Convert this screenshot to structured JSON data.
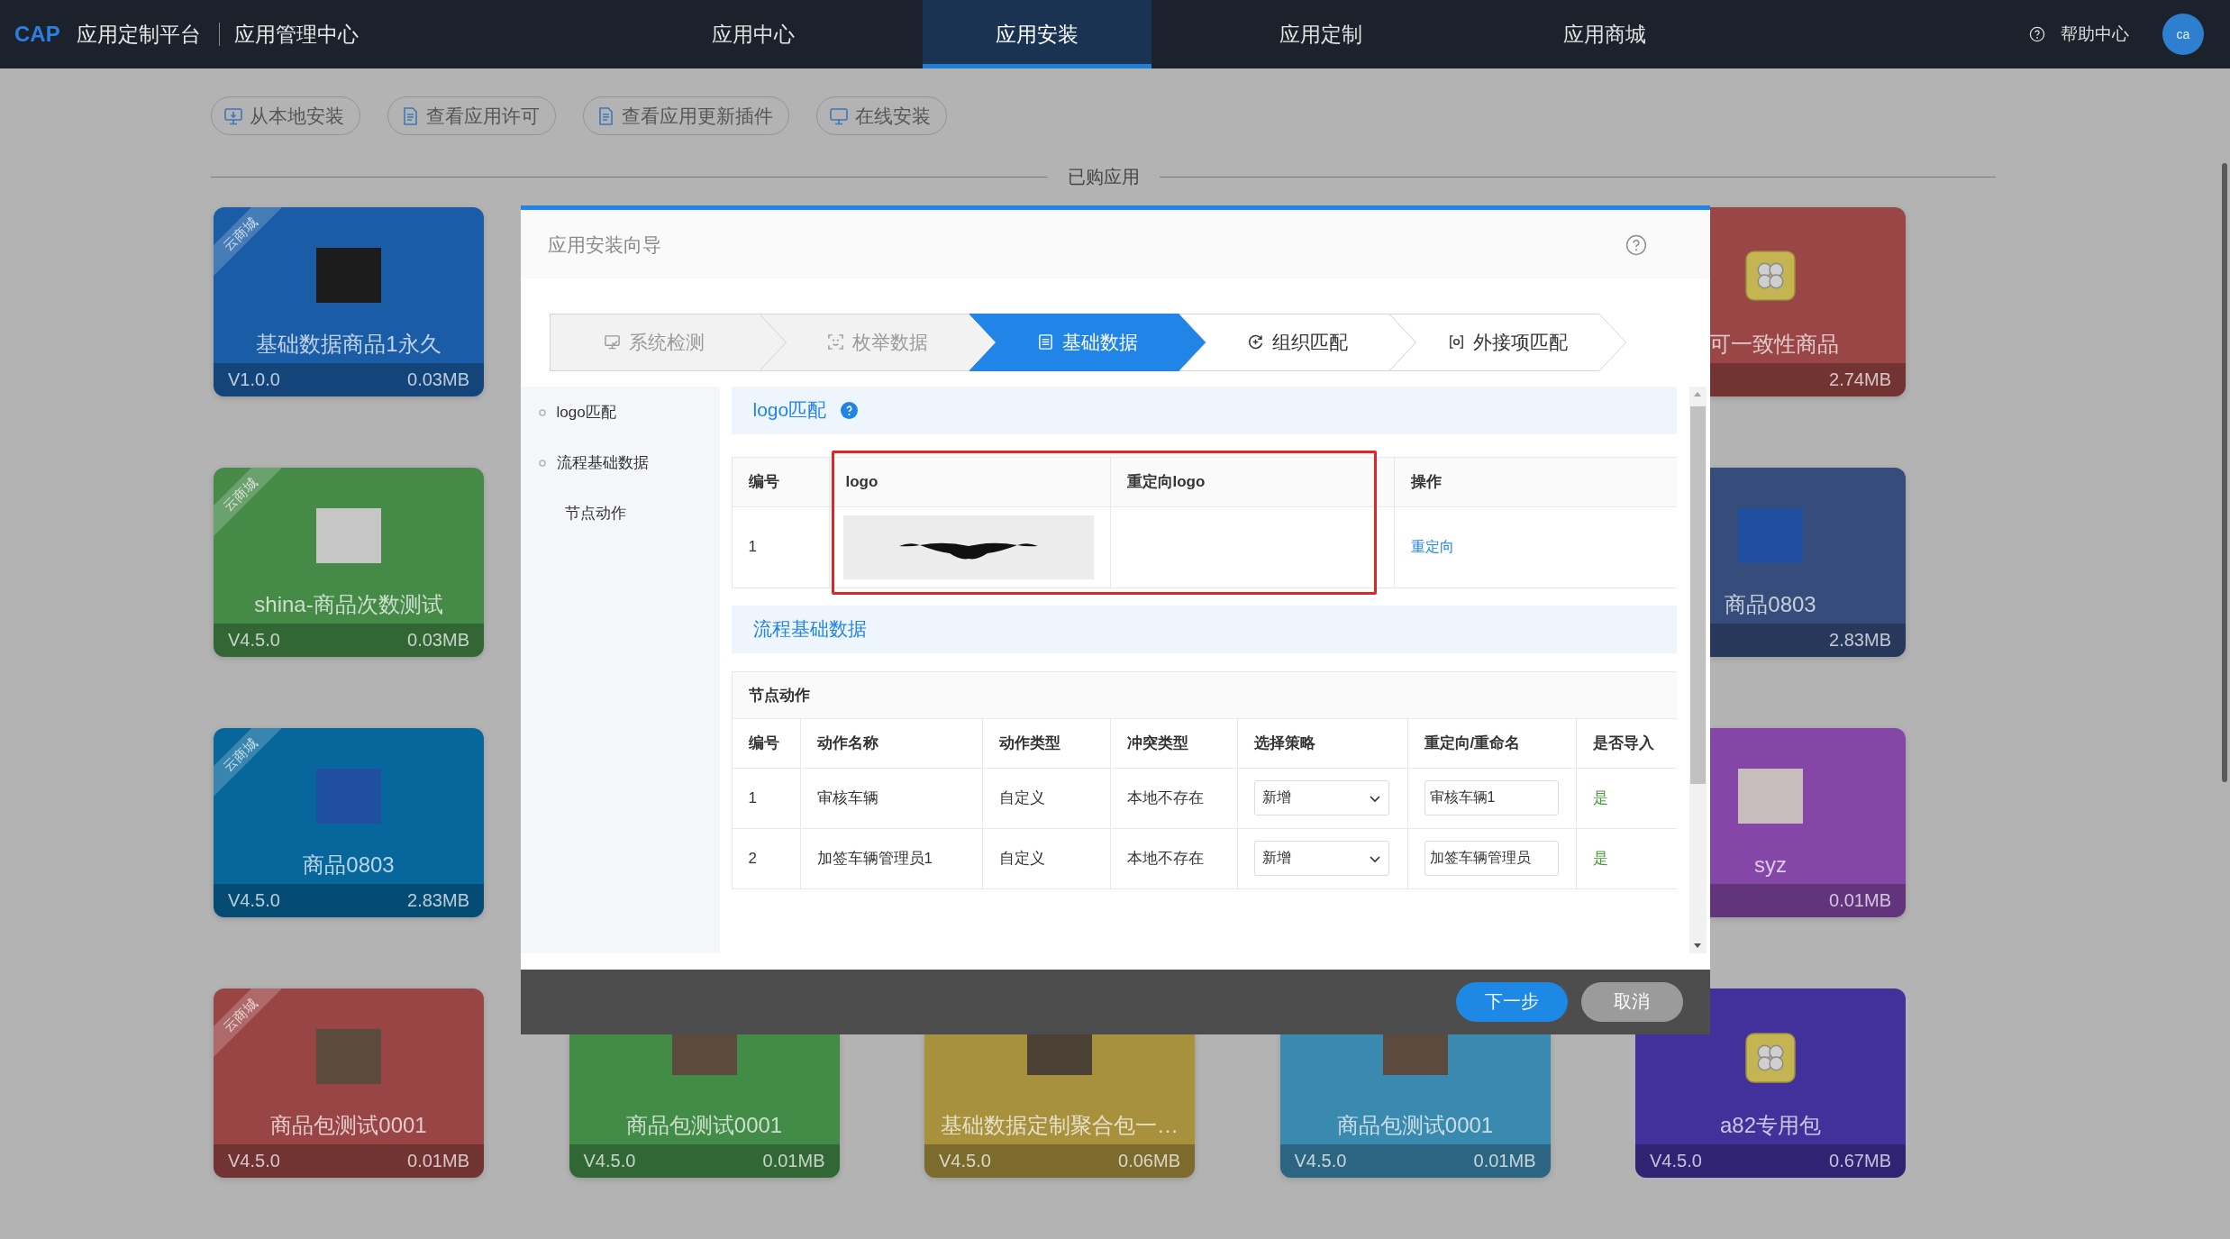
{
  "nav": {
    "brand": "CAP",
    "platform": "应用定制平台",
    "section": "应用管理中心",
    "items": [
      {
        "label": "应用中心",
        "selected": false
      },
      {
        "label": "应用安装",
        "selected": true
      },
      {
        "label": "应用定制",
        "selected": false
      },
      {
        "label": "应用商城",
        "selected": false
      }
    ],
    "help": "帮助中心",
    "avatar": "ca"
  },
  "toolbar": [
    {
      "label": "从本地安装",
      "kind": "download"
    },
    {
      "label": "查看应用许可",
      "kind": "document"
    },
    {
      "label": "查看应用更新插件",
      "kind": "document"
    },
    {
      "label": "在线安装",
      "kind": "monitor"
    }
  ],
  "purchased_heading": "已购应用",
  "card_rows": [
    [
      {
        "kind": "whole",
        "title": "基础数据商品1永久",
        "version": "V1.0.0",
        "size": "0.03MB",
        "color": "#1a5da6",
        "ribbon": "云商城",
        "image": {
          "kind": "photo",
          "color": "#1c1c1c"
        }
      },
      {
        "kind": "right",
        "title": "可一致性商品",
        "size": "2.74MB",
        "color": "#9a4646",
        "image": {
          "kind": "app"
        }
      }
    ],
    [
      {
        "kind": "whole",
        "title": "shina-商品次数测试",
        "version": "V4.5.0",
        "size": "0.03MB",
        "color": "#468a48",
        "ribbon": "云商城",
        "image": {
          "kind": "photo",
          "color": "#c6c6c6"
        }
      },
      {
        "kind": "right",
        "title": "商品0803",
        "size": "2.83MB",
        "color": "#364c7b",
        "image": {
          "kind": "photo",
          "color": "#1f4f9e"
        }
      }
    ],
    [
      {
        "kind": "whole",
        "title": "商品0803",
        "version": "V4.5.0",
        "size": "2.83MB",
        "color": "#07679d",
        "ribbon": "云商城",
        "image": {
          "kind": "photo",
          "color": "#1f4f9e"
        }
      },
      {
        "kind": "right",
        "title": "syz",
        "size": "0.01MB",
        "color": "#8447a7",
        "image": {
          "kind": "photo",
          "color": "#c7bdbd"
        }
      }
    ],
    [
      {
        "kind": "whole",
        "title": "商品包测试0001",
        "version": "V4.5.0",
        "size": "0.01MB",
        "color": "#9a4545",
        "ribbon": "云商城",
        "image": {
          "kind": "photo",
          "color": "#5b4a3d"
        }
      },
      {
        "kind": "lower",
        "title": "商品包测试0001",
        "version": "V4.5.0",
        "size": "0.01MB",
        "color": "#438c48",
        "image": {
          "kind": "photo",
          "color": "#5b4a3d"
        }
      },
      {
        "kind": "lower",
        "title": "基础数据定制聚合包一…",
        "version": "V4.5.0",
        "size": "0.06MB",
        "color": "#a8913d",
        "image": {
          "kind": "photo",
          "color": "#4a4034"
        }
      },
      {
        "kind": "lower",
        "title": "商品包测试0001",
        "version": "V4.5.0",
        "size": "0.01MB",
        "color": "#3a89ae",
        "image": {
          "kind": "photo",
          "color": "#5b4a3d"
        }
      },
      {
        "kind": "notched",
        "title": "a82专用包",
        "version": "V4.5.0",
        "size": "0.67MB",
        "color": "#42309b",
        "image": {
          "kind": "app"
        }
      }
    ]
  ],
  "dialog": {
    "title": "应用安装向导",
    "steps": [
      {
        "label": "系统检测",
        "kind": "monitor",
        "done": true,
        "selected": false
      },
      {
        "label": "枚举数据",
        "kind": "scan",
        "done": true,
        "selected": false
      },
      {
        "label": "基础数据",
        "kind": "list",
        "done": false,
        "selected": true
      },
      {
        "label": "组织匹配",
        "kind": "cycle",
        "done": false,
        "selected": false
      },
      {
        "label": "外接项匹配",
        "kind": "bracket",
        "done": false,
        "selected": false
      }
    ],
    "sidebar": [
      {
        "label": "logo匹配",
        "selected": false
      },
      {
        "label": "流程基础数据",
        "selected": false,
        "children": [
          {
            "label": "节点动作",
            "selected": false
          }
        ]
      }
    ],
    "logo_section": {
      "title": "logo匹配",
      "table": {
        "columns": [
          {
            "label": "编号",
            "marked": false
          },
          {
            "label": "logo",
            "marked": true
          },
          {
            "label": "重定向logo",
            "marked": true
          },
          {
            "label": "操作",
            "marked": false
          }
        ],
        "rows": [
          {
            "number": "1",
            "action": "重定向"
          }
        ]
      }
    },
    "flow_section": {
      "title": "流程基础数据",
      "table": {
        "caption": "节点动作",
        "columns": [
          "编号",
          "动作名称",
          "动作类型",
          "冲突类型",
          "选择策略",
          "重定向/重命名",
          "是否导入"
        ],
        "rows": [
          {
            "number": "1",
            "name": "审核车辆",
            "type": "自定义",
            "conflict": "本地不存在",
            "strategy": "新增",
            "rename": "审核车辆1",
            "import": "是"
          },
          {
            "number": "2",
            "name": "加签车辆管理员1",
            "type": "自定义",
            "conflict": "本地不存在",
            "strategy": "新增",
            "rename": "加签车辆管理员",
            "import": "是"
          }
        ]
      }
    },
    "buttons": [
      {
        "label": "下一步",
        "kind": "primary"
      },
      {
        "label": "取消",
        "kind": "secondary"
      }
    ]
  }
}
